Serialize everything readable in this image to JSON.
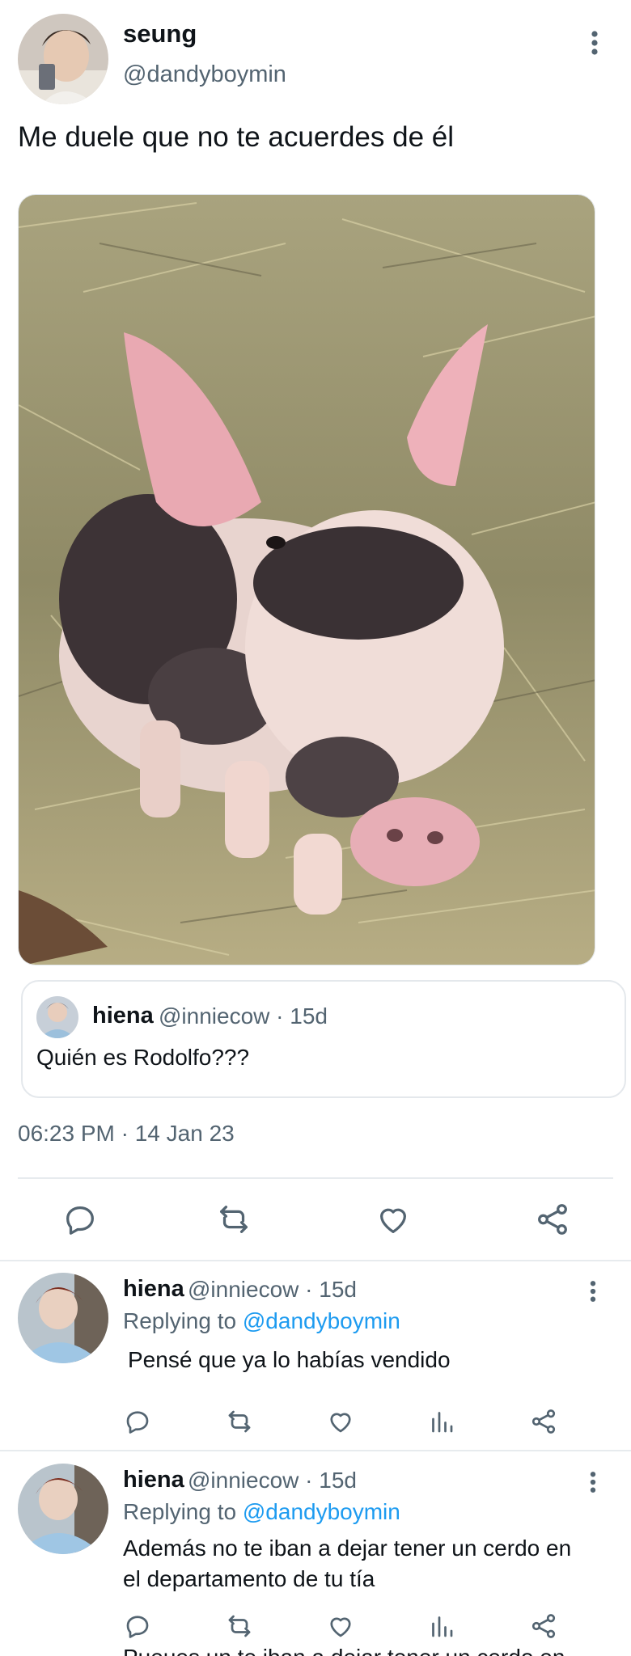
{
  "tweet": {
    "author_name": "seung",
    "author_handle": "@dandyboymin",
    "text": "Me duele que no te acuerdes de él",
    "timestamp": "06:23 PM · 14 Jan 23",
    "photo_icon": "pig-photo"
  },
  "quoted": {
    "name": "hiena",
    "meta": "@inniecow · 15d",
    "text": "Quién es Rodolfo???"
  },
  "main_actions": [
    "reply-icon",
    "retweet-icon",
    "like-icon",
    "share-icon"
  ],
  "replies": [
    {
      "name": "hiena",
      "meta": "@inniecow · 15d",
      "replying_prefix": "Replying to",
      "replying_to": "@dandyboymin",
      "text": "Pensé que ya lo habías vendido"
    },
    {
      "name": "hiena",
      "meta": "@inniecow · 15d",
      "replying_prefix": "Replying to",
      "replying_to": "@dandyboymin",
      "text_line1": "Además no te iban a dejar tener un cerdo en",
      "text_line2": "el departamento de tu tía"
    }
  ],
  "partial_next_text": "Pueues un te iban a dejar tener un cerdo en",
  "colors": {
    "link": "#1d9bf0",
    "secondary": "#536471",
    "divider": "#e7ebee"
  }
}
